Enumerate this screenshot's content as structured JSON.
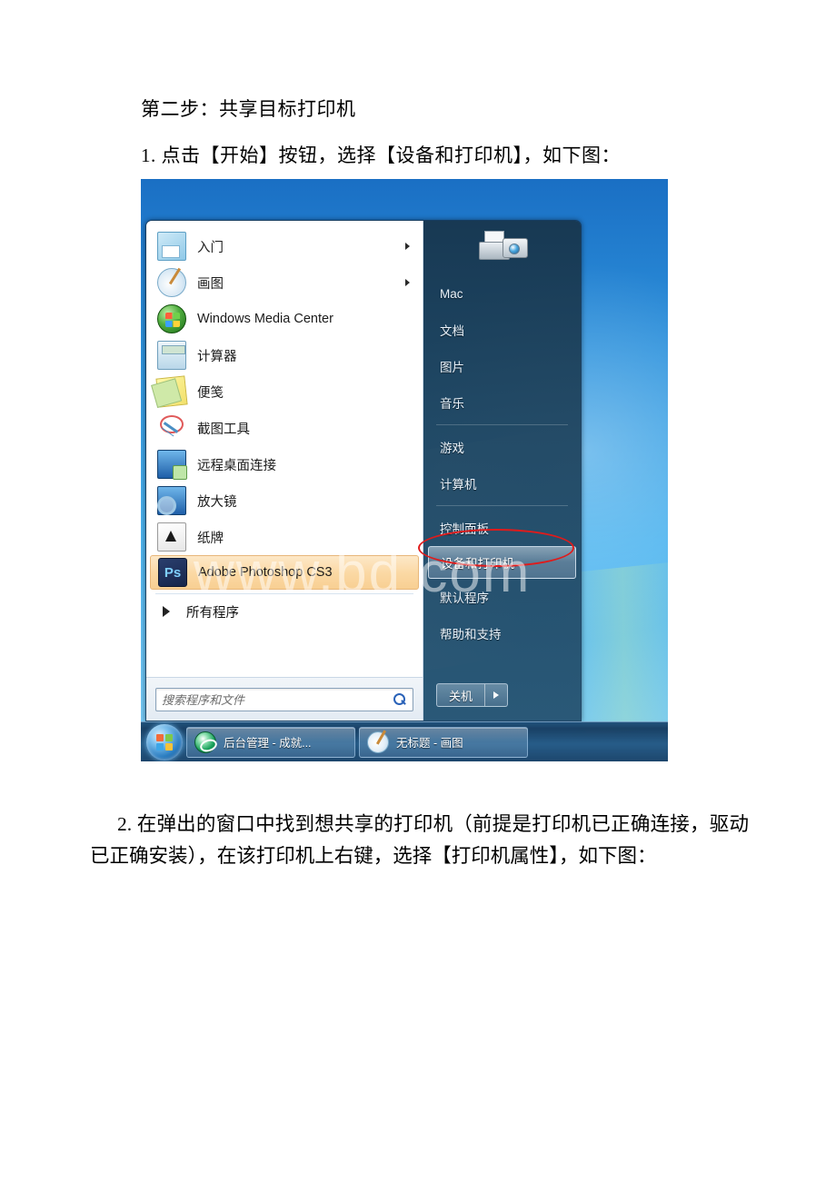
{
  "document": {
    "heading": "第二步：共享目标打印机",
    "step1": "1. 点击【开始】按钮，选择【设备和打印机】，如下图：",
    "step2_indent": "2. 在弹出的窗口中找到想共享的打印机（前提是打印机已正确连接，驱动已正确安装），在该打印机上右键，选择【打印机属性】，如下图："
  },
  "screenshot": {
    "watermark": "www.bd        com",
    "start_menu": {
      "programs": [
        {
          "label": "入门",
          "icon": "getting-started-icon",
          "has_submenu": true
        },
        {
          "label": "画图",
          "icon": "paint-icon",
          "has_submenu": true
        },
        {
          "label": "Windows Media Center",
          "icon": "windows-media-center-icon",
          "has_submenu": false
        },
        {
          "label": "计算器",
          "icon": "calculator-icon",
          "has_submenu": false
        },
        {
          "label": "便笺",
          "icon": "sticky-notes-icon",
          "has_submenu": false
        },
        {
          "label": "截图工具",
          "icon": "snipping-tool-icon",
          "has_submenu": false
        },
        {
          "label": "远程桌面连接",
          "icon": "remote-desktop-icon",
          "has_submenu": false
        },
        {
          "label": "放大镜",
          "icon": "magnifier-icon",
          "has_submenu": false
        },
        {
          "label": "纸牌",
          "icon": "solitaire-icon",
          "has_submenu": false
        },
        {
          "label": "Adobe Photoshop CS3",
          "icon": "photoshop-icon",
          "has_submenu": false,
          "highlighted": true
        }
      ],
      "all_programs": "所有程序",
      "search_placeholder": "搜索程序和文件",
      "right_items": [
        {
          "label": "Mac"
        },
        {
          "label": "文档"
        },
        {
          "label": "图片"
        },
        {
          "label": "音乐"
        },
        {
          "separator": true
        },
        {
          "label": "游戏"
        },
        {
          "label": "计算机"
        },
        {
          "separator": true
        },
        {
          "label": "控制面板"
        },
        {
          "label": "设备和打印机",
          "highlighted": true,
          "annotated": true
        },
        {
          "label": "默认程序"
        },
        {
          "label": "帮助和支持"
        }
      ],
      "shutdown_label": "关机"
    },
    "taskbar": {
      "start_orb": "windows-start-orb",
      "buttons": [
        {
          "label": "后台管理 - 成就...",
          "icon": "internet-explorer-icon"
        },
        {
          "label": "无标题 - 画图",
          "icon": "paint-icon"
        }
      ]
    },
    "annotation_color": "#e01b1b"
  }
}
